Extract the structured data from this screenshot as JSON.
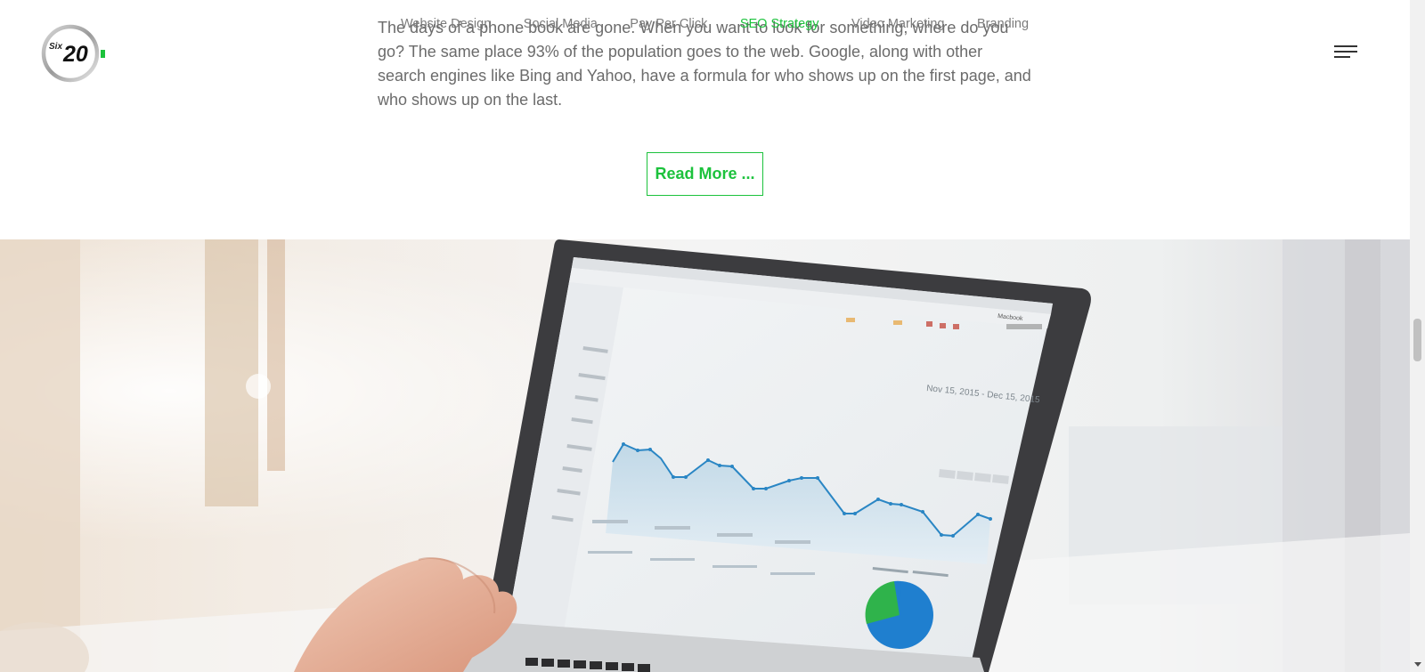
{
  "article": {
    "line1": "The days of a phone book are gone. When you want to look for something, where do you",
    "line2": "go? The same place 93% of the population goes to the web. Google, along with other",
    "line3": "search engines like Bing and Yahoo, have a formula for who shows up on the first page, and",
    "line4": "who shows up on the last."
  },
  "nav": {
    "items": [
      {
        "label": "Website Design"
      },
      {
        "label": "Social Media"
      },
      {
        "label": "Pay Per Click"
      },
      {
        "label": "SEO Strategy",
        "active": true
      },
      {
        "label": "Video Marketing"
      },
      {
        "label": "Branding"
      }
    ]
  },
  "logo": {
    "text_small": "Six",
    "text_big": "20"
  },
  "read_more": {
    "label": "Read More ..."
  },
  "hero": {
    "screen_date_range": "Nov 15, 2015 - Dec 15, 2015",
    "laptop_brand": "Macbook"
  },
  "colors": {
    "accent": "#1cc23c",
    "text": "#6b6b6b",
    "nav": "#7b7b7b"
  },
  "icons": [
    "menu-icon",
    "scroll-down-arrow-icon"
  ]
}
